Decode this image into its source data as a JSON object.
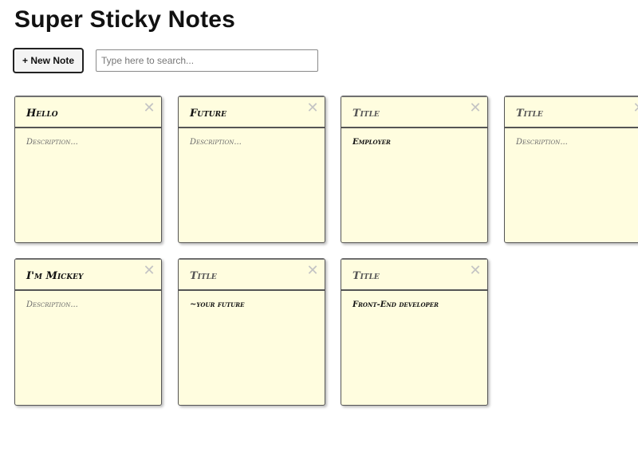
{
  "header": {
    "title": "Super Sticky Notes"
  },
  "toolbar": {
    "new_note_label": "+ New Note",
    "search_placeholder": "Type here to search...",
    "search_value": ""
  },
  "notes": [
    {
      "title": "Hello",
      "title_is_placeholder": false,
      "description": "Description...",
      "description_is_placeholder": true,
      "close_icon": "close-icon"
    },
    {
      "title": "Future",
      "title_is_placeholder": false,
      "description": "Description...",
      "description_is_placeholder": true,
      "close_icon": "close-icon"
    },
    {
      "title": "Title",
      "title_is_placeholder": true,
      "description": "Employer",
      "description_is_placeholder": false,
      "close_icon": "close-icon"
    },
    {
      "title": "Title",
      "title_is_placeholder": true,
      "description": "Description...",
      "description_is_placeholder": true,
      "close_icon": "close-icon"
    },
    {
      "title": "I'm Mickey",
      "title_is_placeholder": false,
      "description": "Description...",
      "description_is_placeholder": true,
      "close_icon": "close-icon"
    },
    {
      "title": "Title",
      "title_is_placeholder": true,
      "description": "~your future",
      "description_is_placeholder": false,
      "close_icon": "close-icon"
    },
    {
      "title": "Title",
      "title_is_placeholder": true,
      "description": "Front-End developer",
      "description_is_placeholder": false,
      "close_icon": "close-icon"
    }
  ],
  "colors": {
    "note_background": "#fffddf",
    "note_border": "#555555",
    "close_icon": "#c4c4c4"
  }
}
